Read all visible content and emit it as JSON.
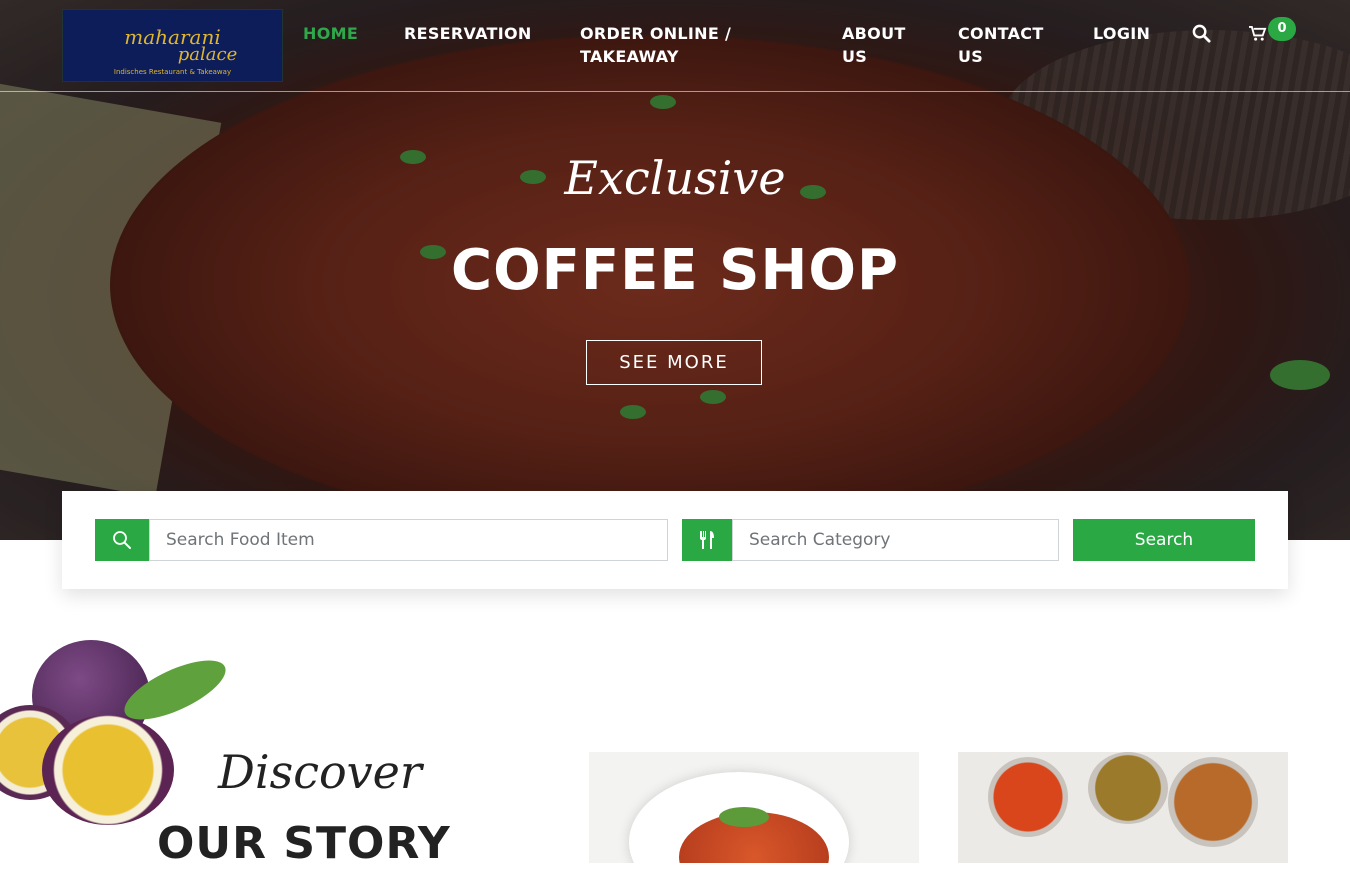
{
  "brand": {
    "logo_line1": "maharani",
    "logo_line2": "palace",
    "logo_tagline": "Indisches Restaurant & Takeaway"
  },
  "nav": {
    "items": [
      {
        "label": "HOME",
        "active": true
      },
      {
        "label": "RESERVATION"
      },
      {
        "label": "ORDER ONLINE /",
        "label2": "TAKEAWAY"
      },
      {
        "label": "ABOUT",
        "label2": "US"
      },
      {
        "label": "CONTACT",
        "label2": "US"
      },
      {
        "label": "LOGIN"
      }
    ],
    "search_icon": "search-icon",
    "cart_icon": "cart-icon",
    "cart_count": "0"
  },
  "hero": {
    "script_title": "Exclusive",
    "headline": "COFFEE SHOP",
    "cta_label": "SEE MORE"
  },
  "search": {
    "food_placeholder": "Search Food Item",
    "category_placeholder": "Search Category",
    "button_label": "Search",
    "food_icon": "search-icon",
    "category_icon": "fork-knife-icon"
  },
  "story": {
    "script": "Discover",
    "title": "OUR STORY"
  },
  "colors": {
    "accent_green": "#2aa844",
    "logo_navy": "#0c1d5a",
    "logo_gold": "#e0b62f"
  }
}
